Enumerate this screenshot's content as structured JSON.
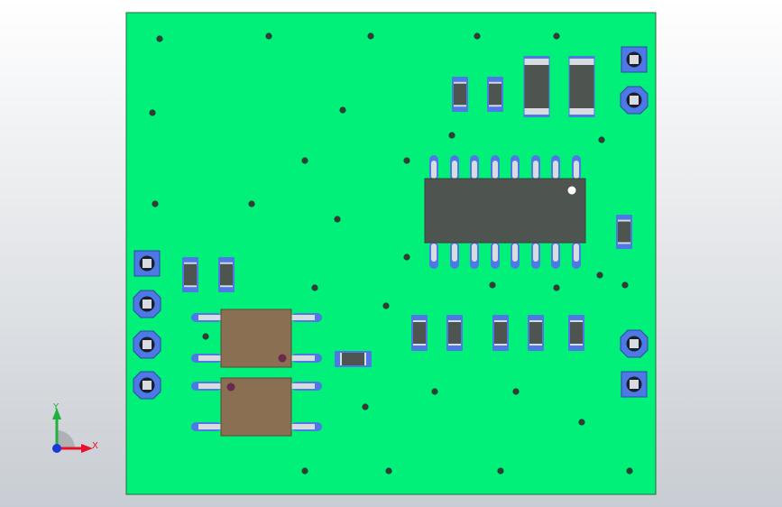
{
  "viewport": {
    "background_top": "#ffffff",
    "background_bottom": "#c8cdd3"
  },
  "board": {
    "color": "#00f07a",
    "edge_color": "#2a6a3a"
  },
  "components": {
    "pad_blue": "#4e78e6",
    "pad_silver": "#d8dbe0",
    "body_dark": "#4e5450",
    "body_bronze": "#8a6f52",
    "via_color": "#2e3e34",
    "pin1_marker": "#ffffff",
    "opto_pin1_marker": "#6a2a50"
  },
  "triad": {
    "x_label": "X",
    "y_label": "Y",
    "x_color": "#e8102a",
    "y_color": "#1fb13c",
    "z_color": "#1a3ad6"
  }
}
